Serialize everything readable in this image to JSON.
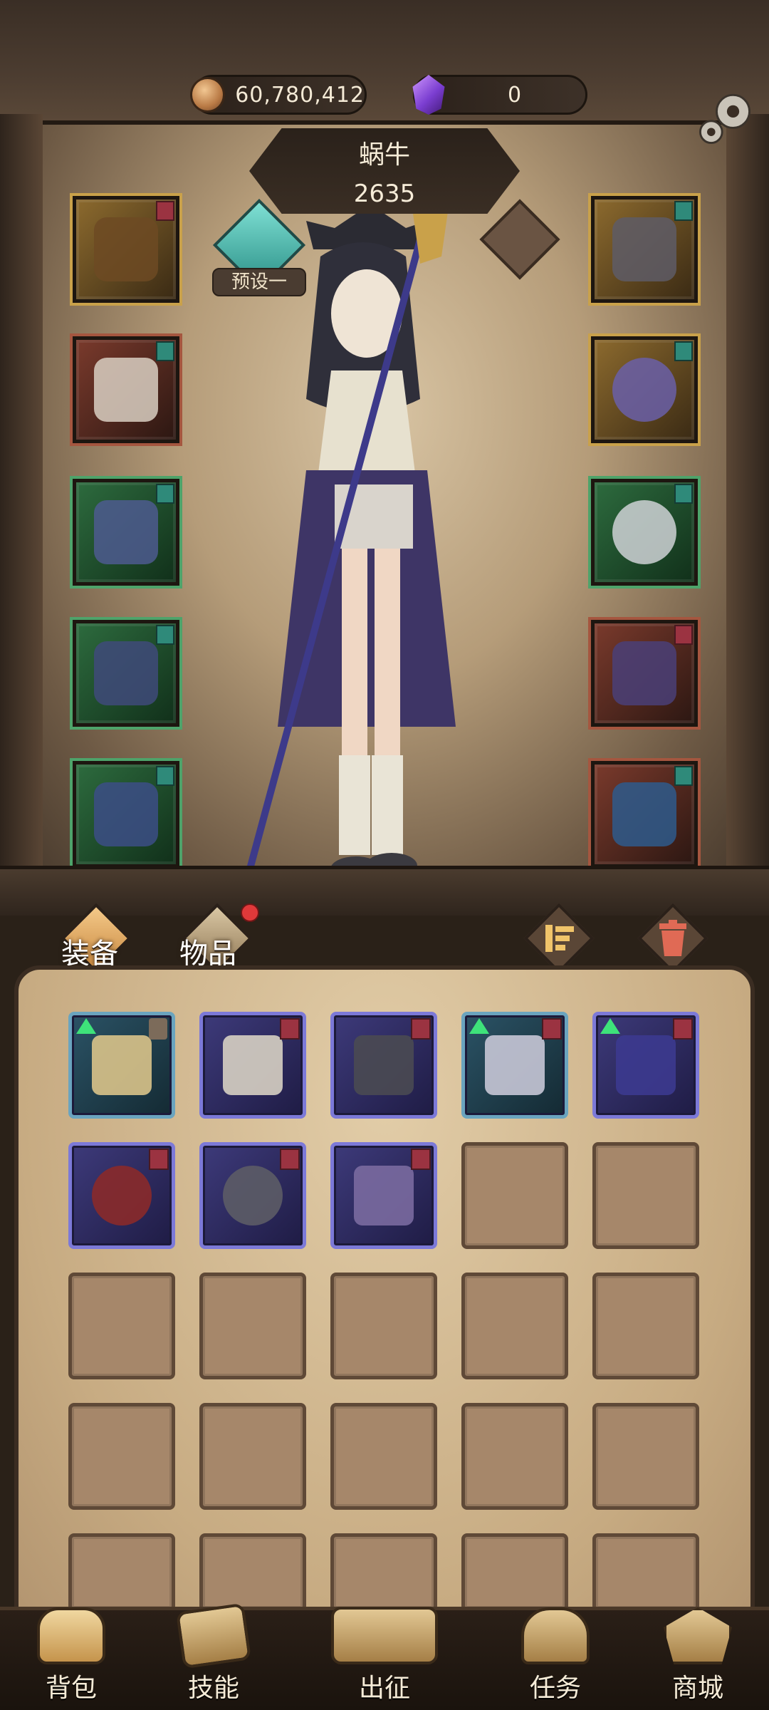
{
  "header": {
    "gold_amount": "60,780,412",
    "gem_amount": "0",
    "icons": [
      "coin-icon",
      "gem-icon",
      "gear-icon"
    ]
  },
  "character": {
    "name": "蜗牛",
    "power": "2635",
    "preset_label": "预设一"
  },
  "equipment_slots": {
    "left": [
      {
        "item": "helmet",
        "quality": "gold",
        "tag_color": "#9b3341"
      },
      {
        "item": "armor",
        "quality": "red",
        "tag_color": "#2f8a7a"
      },
      {
        "item": "gloves",
        "quality": "green",
        "tag_color": "#2f8a7a"
      },
      {
        "item": "pants",
        "quality": "green",
        "tag_color": "#2f8a7a"
      },
      {
        "item": "boots",
        "quality": "green",
        "tag_color": "#2f8a7a"
      }
    ],
    "right": [
      {
        "item": "amulet",
        "quality": "gold",
        "tag_color": "#2f8a7a"
      },
      {
        "item": "ring",
        "quality": "gold",
        "tag_color": "#2f8a7a"
      },
      {
        "item": "ring",
        "quality": "green",
        "tag_color": "#2f8a7a"
      },
      {
        "item": "staff",
        "quality": "red",
        "tag_color": "#9b3341"
      },
      {
        "item": "tome",
        "quality": "red",
        "tag_color": "#2f8a7a"
      }
    ]
  },
  "tabs": {
    "equipment_label": "装备",
    "items_label": "物品",
    "sort_icon": "sort-icon",
    "delete_icon": "trash-icon"
  },
  "inventory": {
    "items": [
      {
        "item": "staff",
        "style": "teal",
        "upgrade": true,
        "locked": true,
        "tag": false
      },
      {
        "item": "robe",
        "style": "purple",
        "upgrade": false,
        "locked": false,
        "tag": true
      },
      {
        "item": "claw",
        "style": "purple",
        "upgrade": false,
        "locked": false,
        "tag": true
      },
      {
        "item": "boots",
        "style": "teal",
        "upgrade": true,
        "locked": false,
        "tag": true
      },
      {
        "item": "tome",
        "style": "purple",
        "upgrade": true,
        "locked": false,
        "tag": true
      },
      {
        "item": "ring",
        "style": "purple",
        "upgrade": false,
        "locked": false,
        "tag": true
      },
      {
        "item": "ring",
        "style": "purple",
        "upgrade": false,
        "locked": false,
        "tag": true
      },
      {
        "item": "amulet",
        "style": "purple",
        "upgrade": false,
        "locked": false,
        "tag": true
      }
    ],
    "empty_cells": 17
  },
  "nav": {
    "bag": "背包",
    "skills": "技能",
    "battle": "出征",
    "quests": "任务",
    "shop": "商城"
  },
  "colors": {
    "accent_gold": "#c9a14a",
    "quality_green": "#4ea36a",
    "quality_red": "#a5563f",
    "quality_purple": "#7c79d8",
    "upgrade_arrow": "#3ee27a"
  }
}
